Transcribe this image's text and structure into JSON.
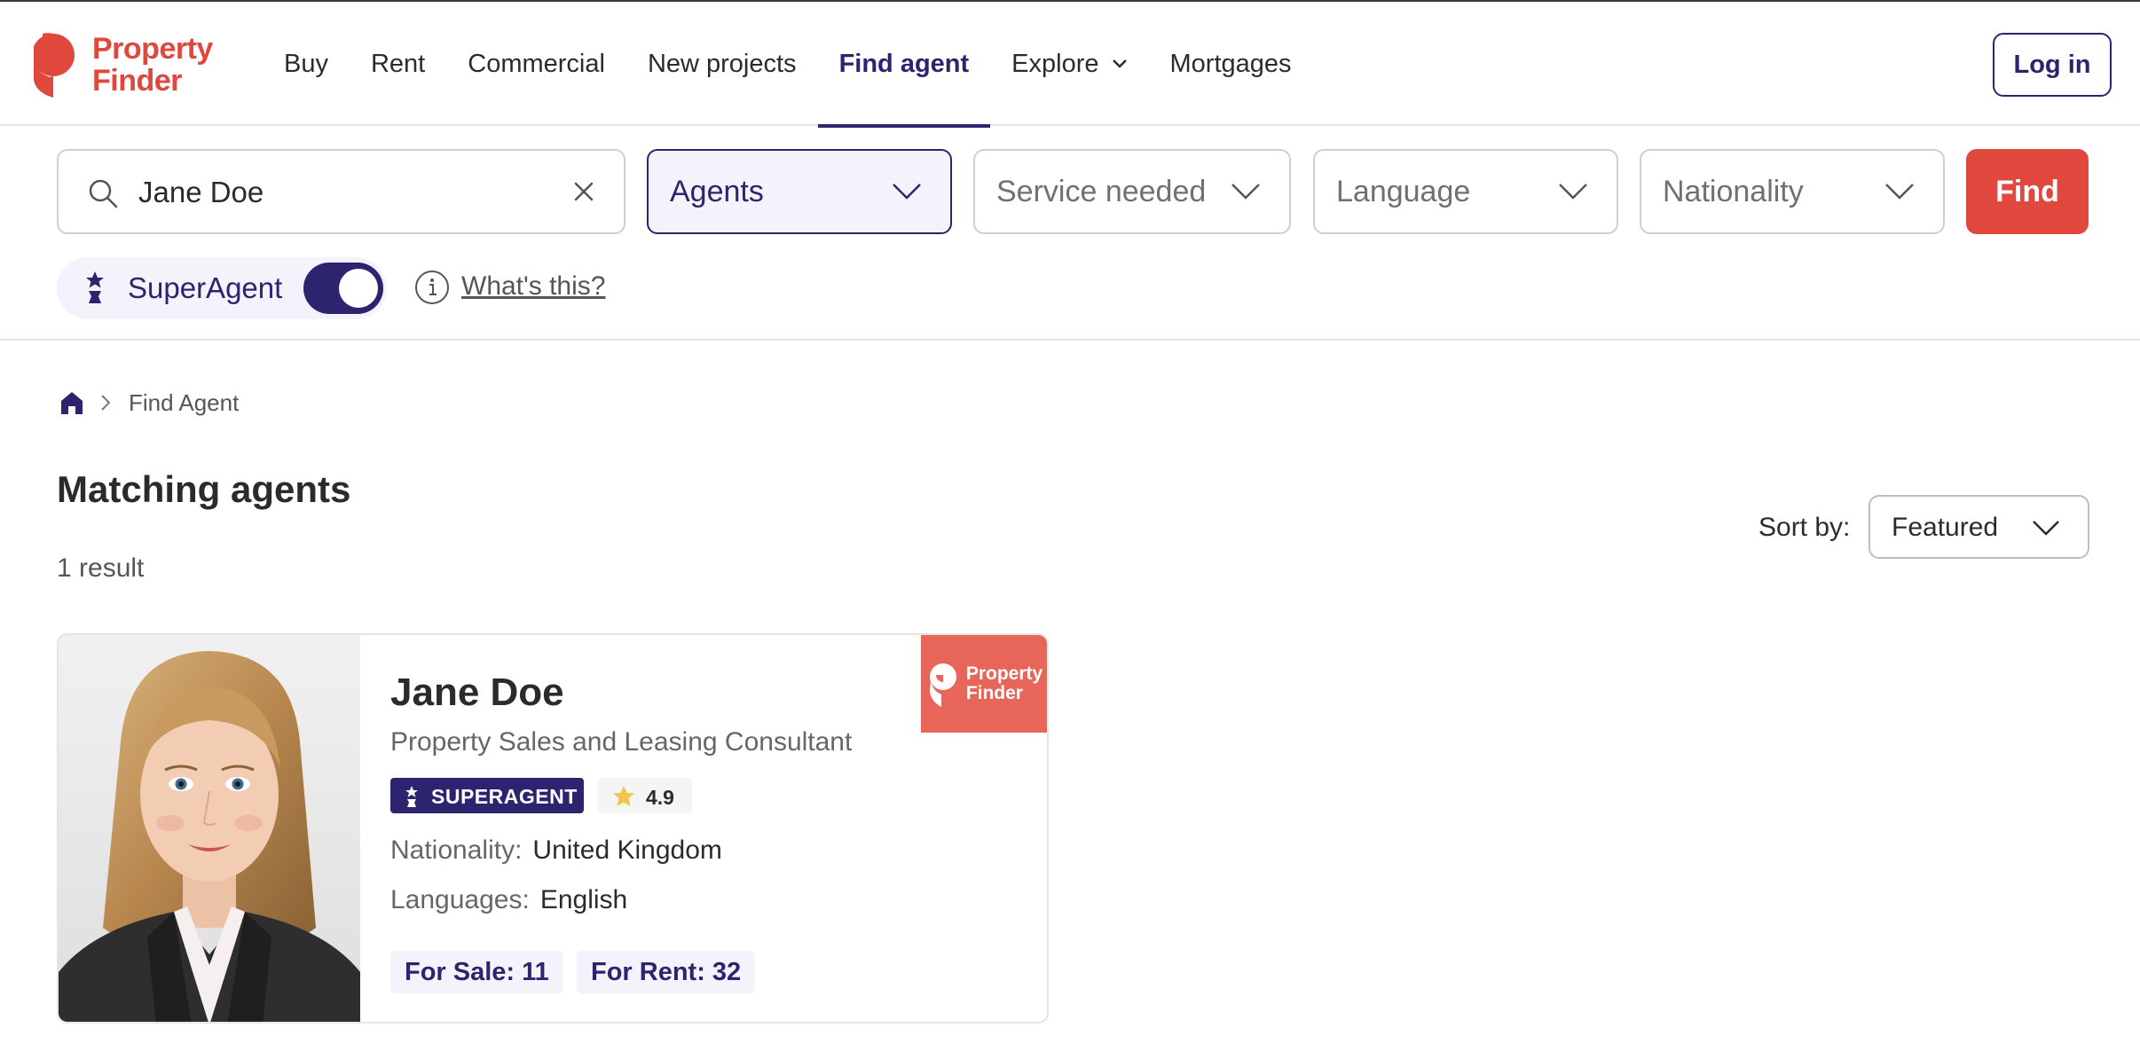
{
  "header": {
    "logo_line1": "Property",
    "logo_line2": "Finder",
    "nav": [
      {
        "label": "Buy"
      },
      {
        "label": "Rent"
      },
      {
        "label": "Commercial"
      },
      {
        "label": "New projects"
      },
      {
        "label": "Find agent",
        "active": true
      },
      {
        "label": "Explore"
      },
      {
        "label": "Mortgages"
      }
    ],
    "login_label": "Log in"
  },
  "search": {
    "query": "Jane Doe",
    "type_selected": "Agents",
    "service_placeholder": "Service needed",
    "language_placeholder": "Language",
    "nationality_placeholder": "Nationality",
    "find_label": "Find"
  },
  "superagent": {
    "label": "SuperAgent",
    "toggle_on": true,
    "whats_this": "What's this?"
  },
  "breadcrumb": {
    "current": "Find Agent"
  },
  "results": {
    "title": "Matching agents",
    "count": "1 result",
    "sort_label": "Sort by:",
    "sort_value": "Featured"
  },
  "agent": {
    "name": "Jane Doe",
    "title": "Property Sales and Leasing Consultant",
    "badge": "SUPERAGENT",
    "rating": "4.9",
    "nationality_label": "Nationality:",
    "nationality": "United Kingdom",
    "languages_label": "Languages:",
    "languages": "English",
    "for_sale": "For Sale: 11",
    "for_rent": "For Rent: 32",
    "agency_line1": "Property",
    "agency_line2": "Finder"
  },
  "colors": {
    "brand_red": "#e0473d",
    "brand_purple": "#2d2470",
    "agency_tile": "#e8655a"
  }
}
